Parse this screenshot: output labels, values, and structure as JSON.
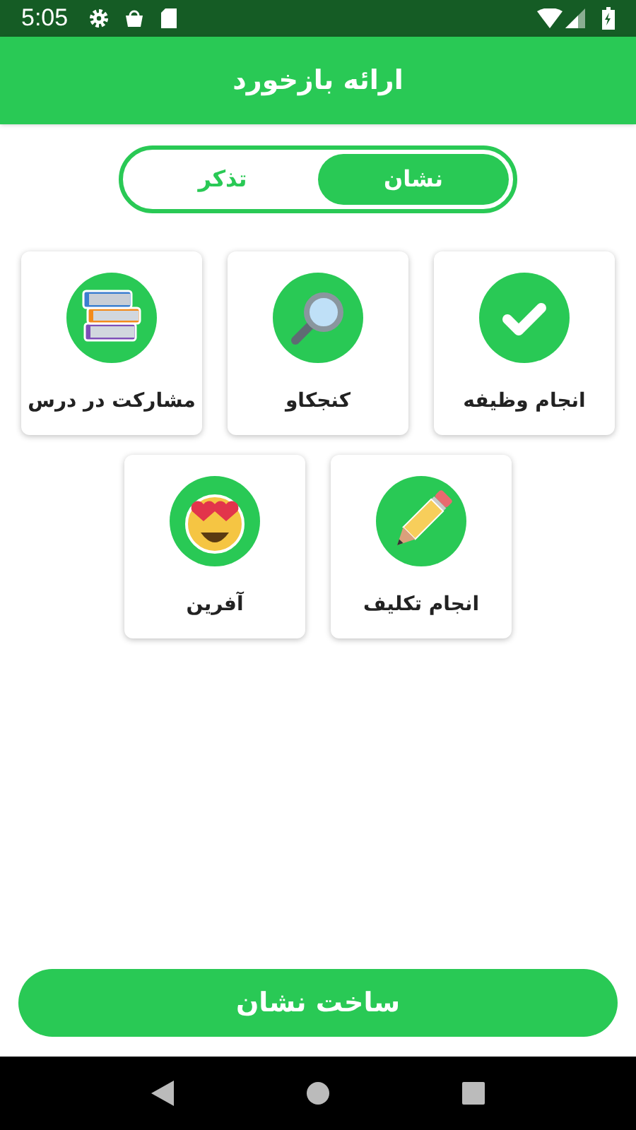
{
  "status_bar": {
    "time": "5:05"
  },
  "header": {
    "title": "ارائه بازخورد"
  },
  "tabs": [
    {
      "label": "نشان",
      "selected": true
    },
    {
      "label": "تذکر",
      "selected": false
    }
  ],
  "cards": [
    {
      "kind": "check",
      "label": "انجام وظیفه"
    },
    {
      "kind": "magnifier",
      "label": "کنجکاو"
    },
    {
      "kind": "books",
      "label": "مشارکت در درس"
    },
    {
      "kind": "pencil",
      "label": "انجام تکلیف"
    },
    {
      "kind": "emoji",
      "label": "آفرین"
    }
  ],
  "action_button": {
    "label": "ساخت نشان"
  }
}
